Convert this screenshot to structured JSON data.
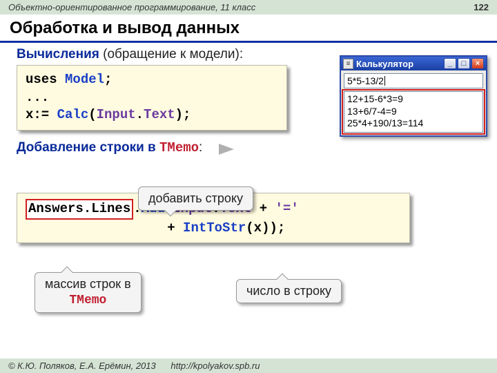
{
  "header": {
    "course": "Объектно-ориентированное программирование, 11 класс",
    "page": "122"
  },
  "title": "Обработка и вывод данных",
  "sec1": {
    "lead": "Вычисления",
    "rest": " (обращение к модели):"
  },
  "code1": {
    "l1a": "uses ",
    "l1b": "Model",
    "l1c": ";",
    "l2": "...",
    "l3a": "x:= ",
    "l3b": "Calc",
    "l3c": "(",
    "l3d": "Input",
    "l3e": ".",
    "l3f": "Text",
    "l3g": ");"
  },
  "sec2": {
    "lead": "Добавление строки в ",
    "mono": "TMemo",
    "tail": ":"
  },
  "bubbles": {
    "add_line": "добавить строку",
    "arr_memo_l1": "массив строк в",
    "arr_memo_l2": "TMemo",
    "num_str": "число в строку"
  },
  "code2": {
    "p1": "Answers.Lines",
    "p2": ".",
    "p3": "Add",
    "p4": "(",
    "p5": "Input",
    "p6": ".",
    "p7": "Text",
    "p8": " + ",
    "p9": "'='",
    "indent": "                  ",
    "p10": "+ ",
    "p11": "IntToStr",
    "p12": "(x));"
  },
  "calc": {
    "title": "Калькулятор",
    "input": "5*5-13/2",
    "lines": [
      "12+15-6*3=9",
      "13+6/7-4=9",
      "25*4+190/13=114"
    ]
  },
  "footer": {
    "copyright": "© К.Ю. Поляков, Е.А. Ерёмин, 2013",
    "url": "http://kpolyakov.spb.ru"
  }
}
